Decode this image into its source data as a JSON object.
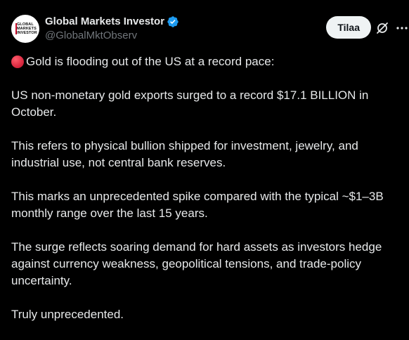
{
  "author": {
    "display_name": "Global Markets Investor",
    "handle": "@GlobalMktObserv",
    "avatar_text": "GLOBAL MARKETS INVESTOR",
    "verified": true
  },
  "actions": {
    "subscribe_label": "Tilaa",
    "grok_icon": "grok-icon",
    "more_icon": "more-icon"
  },
  "tweet": {
    "lead_icon": "red-circle-icon",
    "paragraphs": [
      "Gold is flooding out of the US at a record pace:",
      "US non-monetary gold exports surged to a record $17.1 BILLION in October.",
      "This refers to physical bullion shipped for investment, jewelry, and industrial use, not central bank reserves.",
      "This marks an unprecedented spike compared with the typical ~$1–3B monthly range over the last 15 years.",
      "The surge reflects soaring demand for hard assets as investors hedge against currency weakness, geopolitical tensions, and trade-policy uncertainty.",
      "Truly unprecedented."
    ]
  },
  "colors": {
    "background": "#000000",
    "text": "#e7e9ea",
    "secondary_text": "#71767b",
    "verified_badge": "#1d9bf0",
    "button_bg": "#eff3f4",
    "button_text": "#0f1419",
    "red_circle": "#dd2e44"
  }
}
